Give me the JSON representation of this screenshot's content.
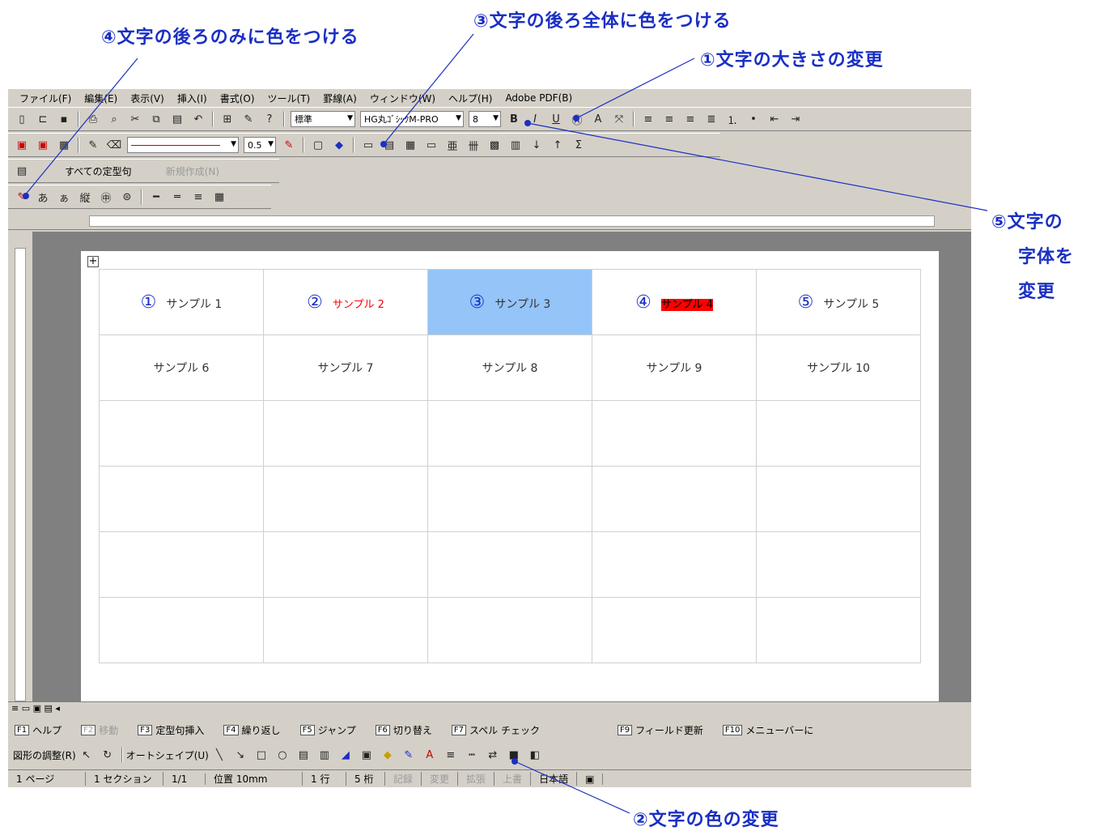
{
  "annotations": {
    "a4": "④文字の後ろのみに色をつける",
    "a3": "③文字の後ろ全体に色をつける",
    "a1": "①文字の大きさの変更",
    "a5_line1": "⑤文字の",
    "a5_line2": "字体を",
    "a5_line3": "変更",
    "a2": "②文字の色の変更"
  },
  "menu": [
    "ファイル(F)",
    "編集(E)",
    "表示(V)",
    "挿入(I)",
    "書式(O)",
    "ツール(T)",
    "罫線(A)",
    "ウィンドウ(W)",
    "ヘルプ(H)",
    "Adobe PDF(B)"
  ],
  "toolbar": {
    "style_value": "標準",
    "font_value": "HG丸ｺﾞｼｯｸM-PRO",
    "size_value": "8",
    "line_weight": "0.5",
    "phrase_label": "すべての定型句",
    "new_label": "新規作成(N)"
  },
  "table": {
    "row1": [
      {
        "num": "①",
        "text": "サンプル 1"
      },
      {
        "num": "②",
        "text": "サンプル 2"
      },
      {
        "num": "③",
        "text": "サンプル 3"
      },
      {
        "num": "④",
        "text": "サンプル 4"
      },
      {
        "num": "⑤",
        "text": "サンプル 5"
      }
    ],
    "row2": [
      "サンプル 6",
      "サンプル 7",
      "サンプル 8",
      "サンプル 9",
      "サンプル 10"
    ]
  },
  "fkeys": [
    {
      "key": "F1",
      "label": "ヘルプ"
    },
    {
      "key": "F2",
      "label": "移動"
    },
    {
      "key": "F3",
      "label": "定型句挿入"
    },
    {
      "key": "F4",
      "label": "繰り返し"
    },
    {
      "key": "F5",
      "label": "ジャンプ"
    },
    {
      "key": "F6",
      "label": "切り替え"
    },
    {
      "key": "F7",
      "label": "スペル チェック"
    },
    {
      "key": "F9",
      "label": "フィールド更新"
    },
    {
      "key": "F10",
      "label": "メニューバーに"
    }
  ],
  "drawbar": {
    "draw_menu": "図形の調整(R)",
    "autoshape": "オートシェイプ(U)"
  },
  "status": {
    "page": "1 ページ",
    "section": "1 セクション",
    "pages": "1/1",
    "position": "位置 10mm",
    "line": "1 行",
    "col": "5 桁",
    "rec": "記録",
    "trk": "変更",
    "ext": "拡張",
    "ovr": "上書",
    "lang": "日本語"
  },
  "colors": {
    "annotation": "#1a2fc4",
    "highlight_cell": "#94c4f8",
    "red_text": "#ff0000",
    "chrome": "#d4d0c8"
  }
}
